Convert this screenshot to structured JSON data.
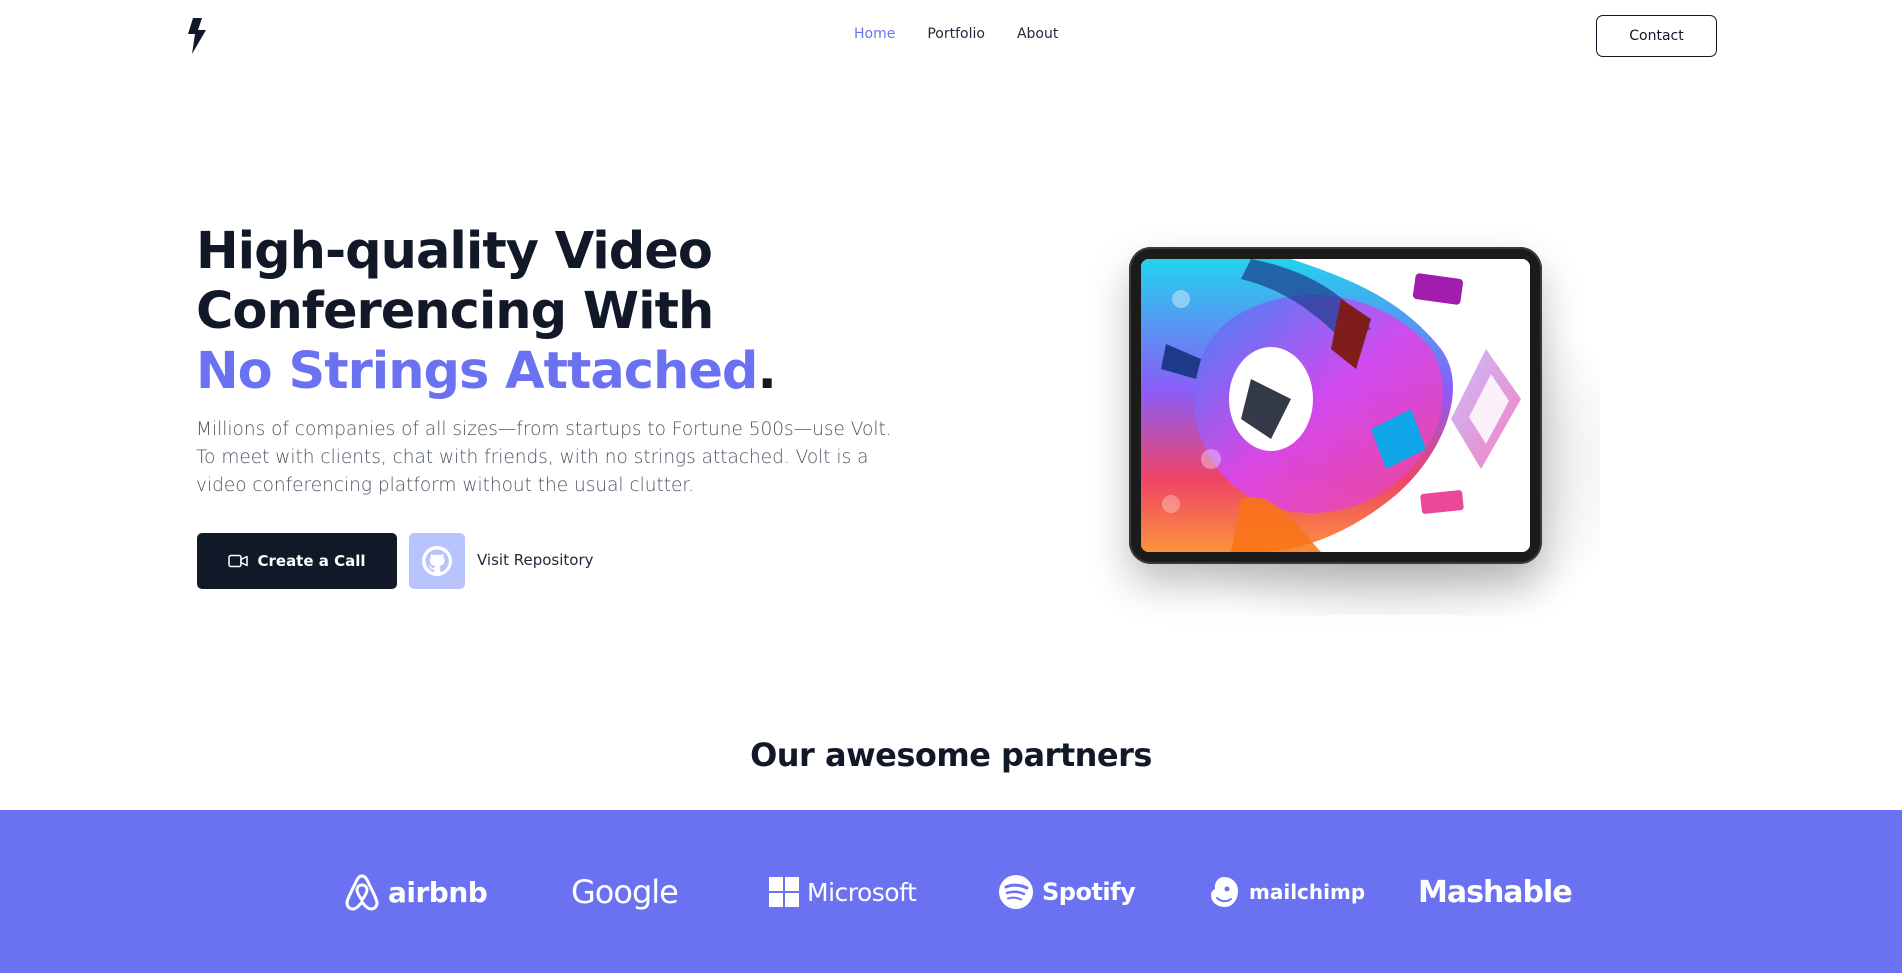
{
  "header": {
    "logo_icon": "lightning-bolt-icon",
    "nav": [
      {
        "label": "Home",
        "active": true
      },
      {
        "label": "Portfolio",
        "active": false
      },
      {
        "label": "About",
        "active": false
      }
    ],
    "contact_label": "Contact"
  },
  "hero": {
    "title_line1": "High-quality Video",
    "title_line2": "Conferencing With",
    "title_accent": "No Strings Attached",
    "title_period": ".",
    "description": "Millions of companies of all sizes—from startups to Fortune 500s—use Volt. To meet with clients, chat with friends, with no strings attached. Volt is a video conferencing platform without the usual clutter.",
    "create_call_label": "Create a Call",
    "create_call_icon": "video-camera-icon",
    "github_icon": "github-icon",
    "repo_label": "Visit Repository"
  },
  "partners": {
    "title": "Our awesome partners",
    "logos": [
      {
        "name": "airbnb",
        "icon": "airbnb-icon"
      },
      {
        "name": "Google",
        "icon": ""
      },
      {
        "name": "Microsoft",
        "icon": "microsoft-icon"
      },
      {
        "name": "Spotify",
        "icon": "spotify-icon"
      },
      {
        "name": "mailchimp",
        "icon": "mailchimp-icon"
      },
      {
        "name": "Mashable",
        "icon": ""
      }
    ]
  },
  "colors": {
    "accent": "#6b72f1",
    "dark": "#111827",
    "band": "#6b72f1",
    "github_button": "#b8c3fb"
  }
}
